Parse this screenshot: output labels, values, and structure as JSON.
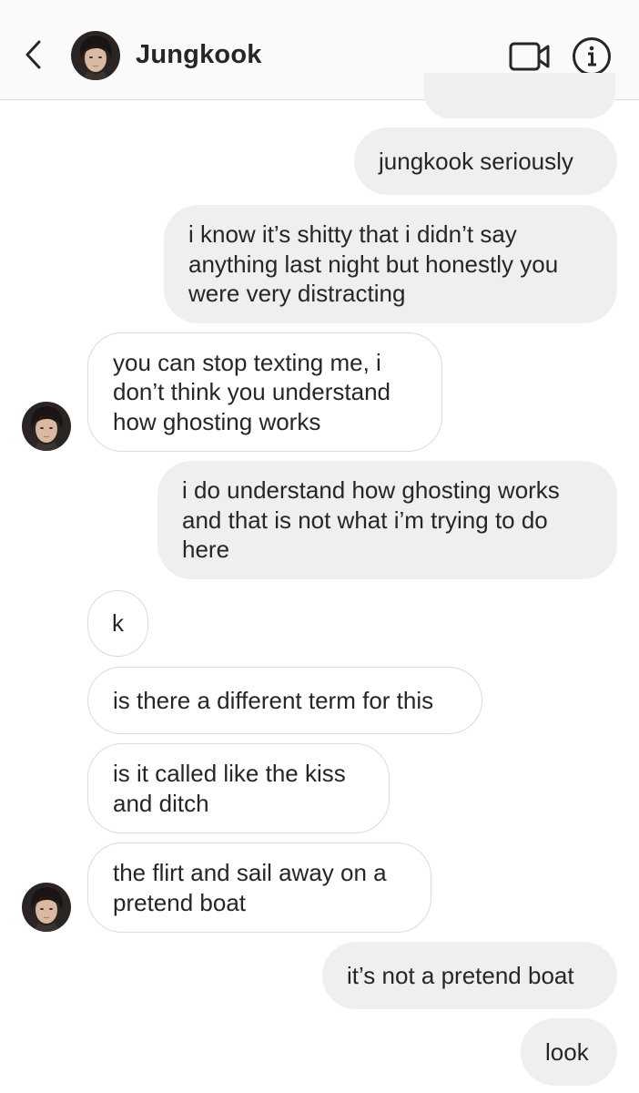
{
  "header": {
    "contact_name": "Jungkook",
    "back_icon": "chevron-left-icon",
    "video_icon": "video-camera-icon",
    "info_icon": "info-icon"
  },
  "messages": [
    {
      "direction": "sent",
      "text": "jungkook seriously"
    },
    {
      "direction": "sent",
      "text": "i know it’s shitty that i didn’t say\nanything last night but honestly you\nwere very distracting"
    },
    {
      "direction": "received",
      "text": "you can stop texting me, i\ndon’t think you understand\nhow ghosting works"
    },
    {
      "direction": "sent",
      "text": "i do understand how ghosting works\nand that is not what i’m trying to do\nhere"
    },
    {
      "direction": "received",
      "text": "k"
    },
    {
      "direction": "received",
      "text": "is there a different term for this"
    },
    {
      "direction": "received",
      "text": "is it called like the kiss\nand ditch"
    },
    {
      "direction": "received",
      "text": "the flirt and sail away on a\npretend boat"
    },
    {
      "direction": "sent",
      "text": "it’s not a pretend boat"
    },
    {
      "direction": "sent",
      "text": "look"
    }
  ],
  "colors": {
    "sent_bubble": "#efefef",
    "received_bubble_border": "#dbdbdb",
    "text": "#262626",
    "header_bg": "#fafafa"
  }
}
